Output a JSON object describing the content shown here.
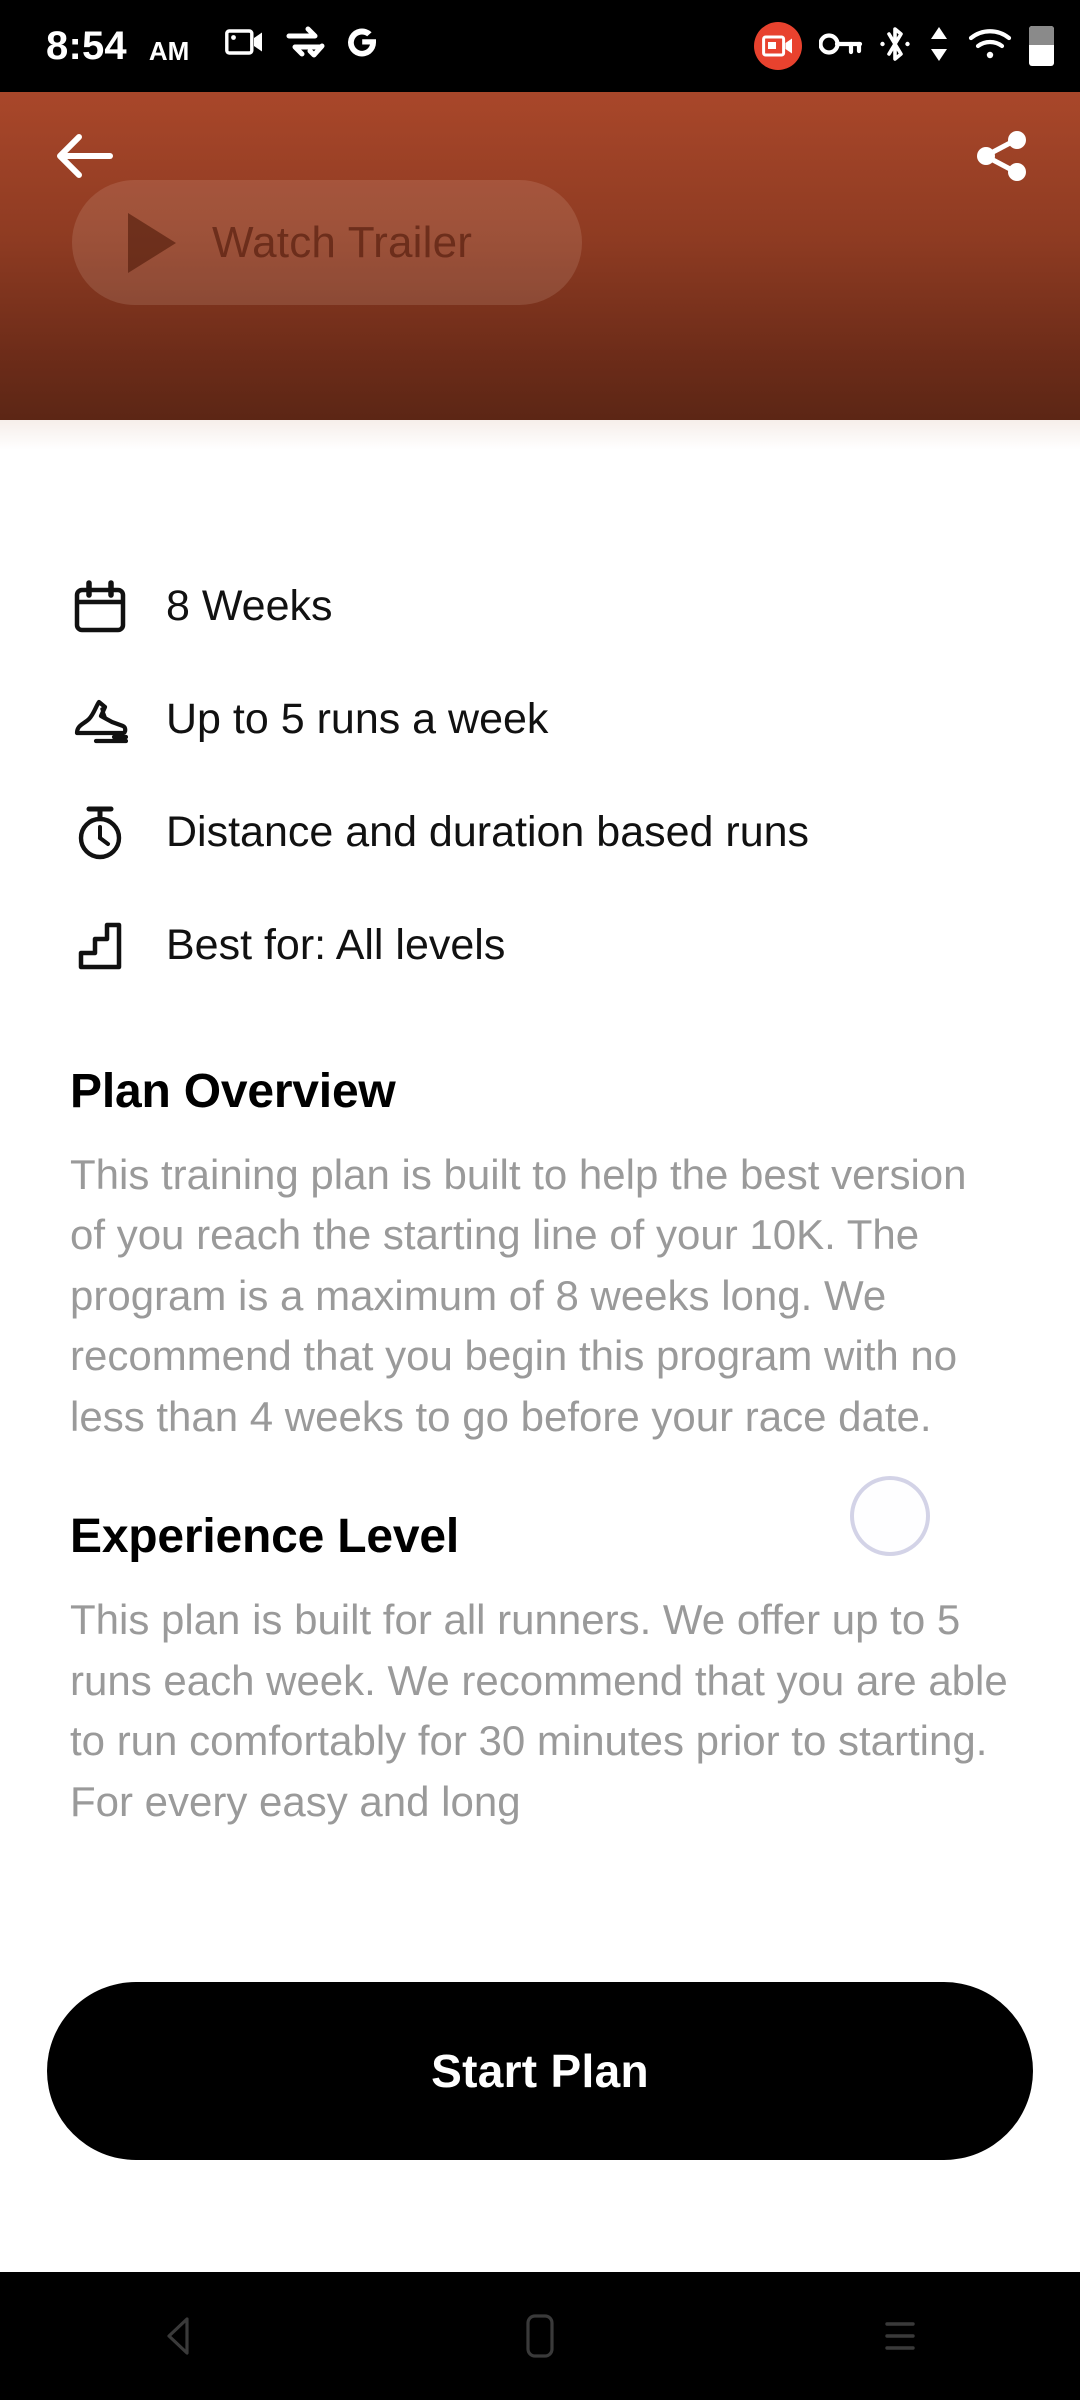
{
  "status_bar": {
    "time": "8:54",
    "meridiem": "AM",
    "left_icons": [
      "video-camera-icon",
      "vpn-swap-icon",
      "google-g-icon"
    ],
    "right_icons": [
      "screen-record-badge-icon",
      "vpn-key-icon",
      "bluetooth-icon",
      "data-transfer-icon",
      "wifi-icon",
      "battery-icon"
    ],
    "record_badge_color": "#e8422e",
    "background": "#000000"
  },
  "header": {
    "back_label": "Back",
    "share_label": "Share",
    "trailer_button_label": "Watch Trailer",
    "gradient_top": "#a9472a",
    "gradient_bottom": "#5c2615"
  },
  "specs": [
    {
      "icon": "calendar-icon",
      "label": "8 Weeks"
    },
    {
      "icon": "running-shoe-icon",
      "label": "Up to 5 runs a week"
    },
    {
      "icon": "stopwatch-icon",
      "label": "Distance and duration based runs"
    },
    {
      "icon": "stairs-level-icon",
      "label": "Best for: All levels"
    }
  ],
  "sections": [
    {
      "title": "Plan Overview",
      "body": "This training plan is built to help the best version of you reach the starting line of your 10K. The program is a maximum of 8 weeks long. We recommend that you begin this program with no less than 4 weeks to go before your race date."
    },
    {
      "title": "Experience Level",
      "body": "This plan is built for all runners. We offer up to 5 runs each week. We recommend that you are able to run comfortably for 30 minutes prior to starting. For every easy and long"
    }
  ],
  "cta": {
    "label": "Start Plan",
    "background": "#000000",
    "text_color": "#ffffff"
  },
  "nav_bar": {
    "items": [
      "back-nav-icon",
      "home-nav-icon",
      "recents-nav-icon"
    ],
    "background": "#000000"
  }
}
